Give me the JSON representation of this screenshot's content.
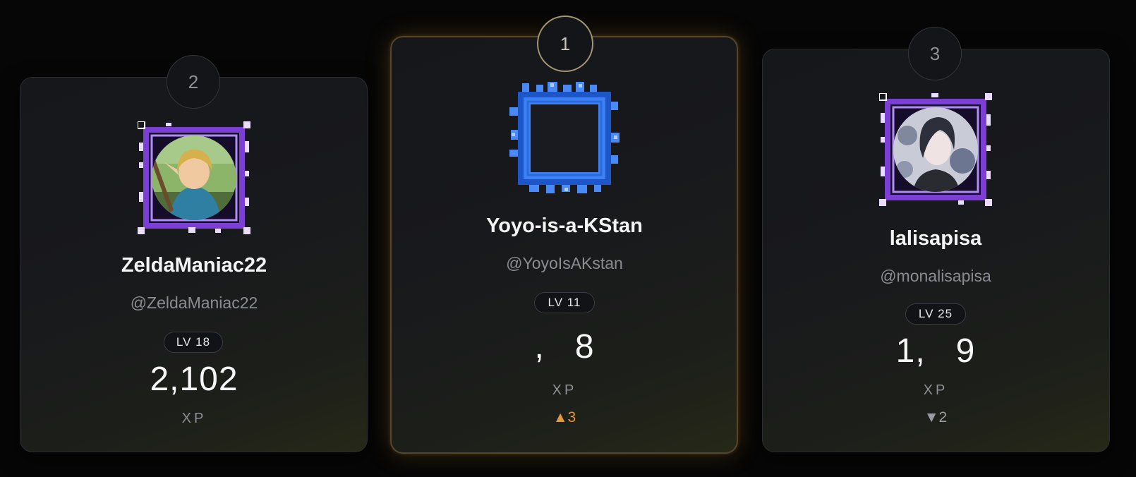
{
  "leaderboard": {
    "second": {
      "rank": "2",
      "display_name": "ZeldaManiac22",
      "handle": "@ZeldaManiac22",
      "level": "LV 18",
      "xp": "2,102",
      "xp_label": "XP",
      "avatar": "link-avatar",
      "frame_color": "#7b3fd6"
    },
    "first": {
      "rank": "1",
      "display_name": "Yoyo-is-a-KStan",
      "handle": "@YoyoIsAKstan",
      "level": "LV 11",
      "xp": ",   8",
      "xp_label": "XP",
      "delta": "▲3",
      "avatar": "empty-avatar",
      "frame_color": "#2f6fe6"
    },
    "third": {
      "rank": "3",
      "display_name": "lalisapisa",
      "handle": "@monalisapisa",
      "level": "LV 25",
      "xp": "1,   9",
      "xp_label": "XP",
      "delta": "▼2",
      "avatar": "anime-avatar",
      "frame_color": "#7b3fd6"
    }
  }
}
